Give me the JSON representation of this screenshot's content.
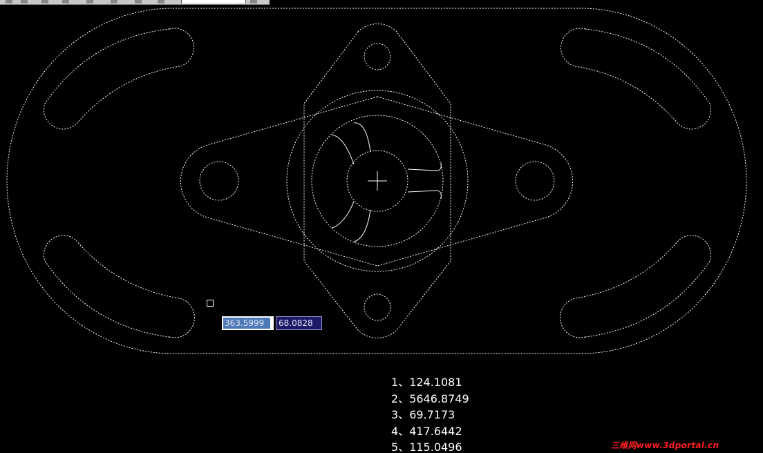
{
  "dynamic_input": {
    "x_value": "363.5999",
    "y_value": "68.0828"
  },
  "results": [
    {
      "index": "1、",
      "value": "124.1081"
    },
    {
      "index": "2、",
      "value": "5646.8749"
    },
    {
      "index": "3、",
      "value": "69.7173"
    },
    {
      "index": "4、",
      "value": "417.6442"
    },
    {
      "index": "5、",
      "value": "115.0496"
    }
  ],
  "watermark": {
    "text": "三维网www.3dportal.cn"
  },
  "colors": {
    "background": "#000000",
    "linework": "#ffffff",
    "input_highlight": "#4d79b8",
    "input_secondary": "#1c1a66",
    "watermark": "#ff2020"
  }
}
